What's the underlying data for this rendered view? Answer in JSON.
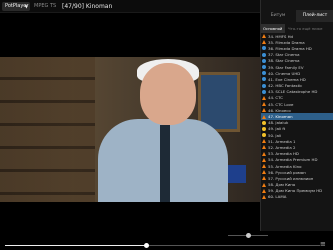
{
  "header": {
    "app_label": "PotPlayer",
    "format": "MPEG TS",
    "title": "[47/90] Kinoman"
  },
  "panel": {
    "tabs": [
      "Битум",
      "Плей-лист"
    ],
    "subtabs": [
      "Основной",
      "Что-то ещё ниже"
    ],
    "channels": [
      {
        "label": "34. HMFS Hd",
        "icon": "cone"
      },
      {
        "label": "35. Filmzda Drama",
        "icon": "cone"
      },
      {
        "label": "36. Filmzda Drama HD",
        "icon": "globe"
      },
      {
        "label": "37. Star Cinema",
        "icon": "globe"
      },
      {
        "label": "38. Star Cinema",
        "icon": "globe"
      },
      {
        "label": "39. Star Family EV",
        "icon": "globe"
      },
      {
        "label": "40. Cinema UHD",
        "icon": "globe"
      },
      {
        "label": "41. Eve Cinema HD",
        "icon": "globe"
      },
      {
        "label": "42. HBC Fantastic",
        "icon": "globe"
      },
      {
        "label": "43. SCLE Catastrophe HD",
        "icon": "globe"
      },
      {
        "label": "44. CTC",
        "icon": "cone"
      },
      {
        "label": "45. CTC Love",
        "icon": "cone"
      },
      {
        "label": "46. Kinoeco",
        "icon": "cone"
      },
      {
        "label": "47. Kinoman",
        "icon": "cone",
        "selected": true
      },
      {
        "label": "48. Jalaluk",
        "icon": "sun"
      },
      {
        "label": "49. Jali ft",
        "icon": "sun"
      },
      {
        "label": "50. Jali",
        "icon": "sun"
      },
      {
        "label": "51. Armedia 1",
        "icon": "cone"
      },
      {
        "label": "52. Armedia 2",
        "icon": "cone"
      },
      {
        "label": "53. Armedia HD",
        "icon": "cone"
      },
      {
        "label": "54. Armedia Premium HD",
        "icon": "cone"
      },
      {
        "label": "55. Armedia Kino",
        "icon": "cone"
      },
      {
        "label": "56. Русский роман",
        "icon": "cone"
      },
      {
        "label": "57. Русский иллюзион",
        "icon": "cone"
      },
      {
        "label": "58. Дом Кино",
        "icon": "cone"
      },
      {
        "label": "59. Дом Кино Премиум HD",
        "icon": "cone"
      },
      {
        "label": "60. LAMA",
        "icon": "cone"
      }
    ]
  },
  "controls": {
    "seek_progress": 0.45,
    "volume": 0.5
  }
}
